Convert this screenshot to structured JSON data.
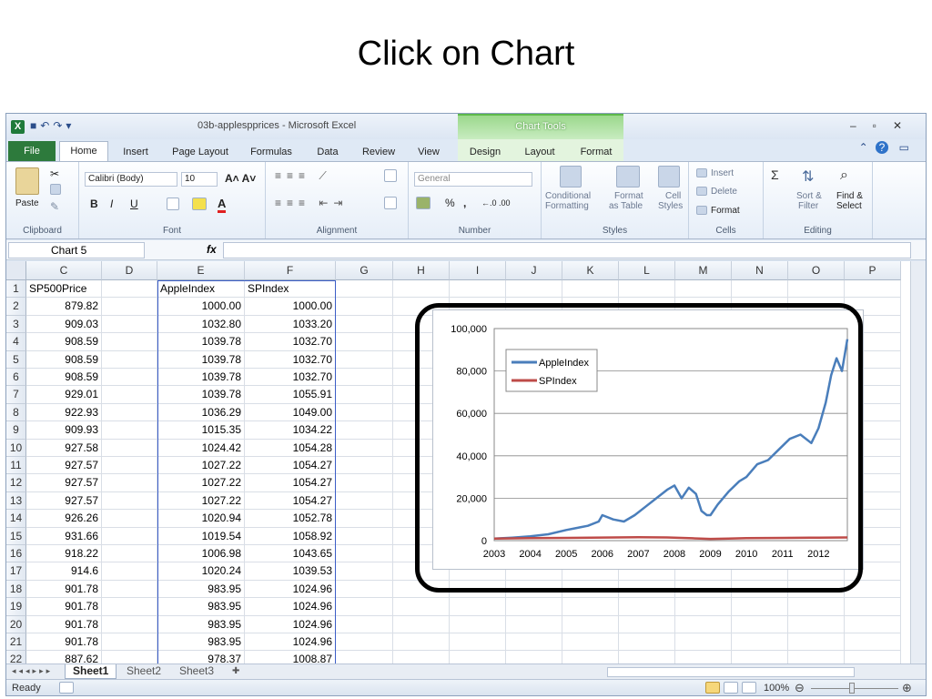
{
  "slide_title": "Click on Chart",
  "window": {
    "title": "03b-applespprices - Microsoft Excel",
    "context_tab_group": "Chart Tools",
    "qat_icons": [
      "save-icon",
      "undo-icon",
      "redo-icon",
      "customize-icon"
    ]
  },
  "ribbon_tabs": [
    "File",
    "Home",
    "Insert",
    "Page Layout",
    "Formulas",
    "Data",
    "Review",
    "View",
    "Design",
    "Layout",
    "Format"
  ],
  "ribbon": {
    "clipboard": {
      "paste": "Paste",
      "label": "Clipboard"
    },
    "font": {
      "family": "Calibri (Body)",
      "size": "10",
      "bold": "B",
      "italic": "I",
      "underline": "U",
      "label": "Font"
    },
    "alignment": {
      "label": "Alignment"
    },
    "number": {
      "format": "General",
      "percent": "%",
      "comma": ",",
      "inc": "←.0 .00",
      "dec": ".00 →.0",
      "label": "Number"
    },
    "styles": {
      "conditional": "Conditional",
      "conditional2": "Formatting",
      "format_table": "Format",
      "format_table2": "as Table",
      "cell_styles": "Cell",
      "cell_styles2": "Styles",
      "label": "Styles"
    },
    "cells": {
      "insert": "Insert",
      "delete": "Delete",
      "format": "Format",
      "label": "Cells"
    },
    "editing": {
      "sum": "Σ",
      "sort": "Sort &",
      "sort2": "Filter",
      "find": "Find &",
      "find2": "Select",
      "label": "Editing"
    }
  },
  "formula_bar": {
    "name_box": "Chart 5",
    "fx": "fx",
    "value": ""
  },
  "columns": [
    "C",
    "D",
    "E",
    "F",
    "G",
    "H",
    "I",
    "J",
    "K",
    "L",
    "M",
    "N",
    "O",
    "P"
  ],
  "rows": [
    {
      "n": "1",
      "c": "SP500Price",
      "e": "AppleIndex",
      "f": "SPIndex"
    },
    {
      "n": "2",
      "c": "879.82",
      "e": "1000.00",
      "f": "1000.00"
    },
    {
      "n": "3",
      "c": "909.03",
      "e": "1032.80",
      "f": "1033.20"
    },
    {
      "n": "4",
      "c": "908.59",
      "e": "1039.78",
      "f": "1032.70"
    },
    {
      "n": "5",
      "c": "908.59",
      "e": "1039.78",
      "f": "1032.70"
    },
    {
      "n": "6",
      "c": "908.59",
      "e": "1039.78",
      "f": "1032.70"
    },
    {
      "n": "7",
      "c": "929.01",
      "e": "1039.78",
      "f": "1055.91"
    },
    {
      "n": "8",
      "c": "922.93",
      "e": "1036.29",
      "f": "1049.00"
    },
    {
      "n": "9",
      "c": "909.93",
      "e": "1015.35",
      "f": "1034.22"
    },
    {
      "n": "10",
      "c": "927.58",
      "e": "1024.42",
      "f": "1054.28"
    },
    {
      "n": "11",
      "c": "927.57",
      "e": "1027.22",
      "f": "1054.27"
    },
    {
      "n": "12",
      "c": "927.57",
      "e": "1027.22",
      "f": "1054.27"
    },
    {
      "n": "13",
      "c": "927.57",
      "e": "1027.22",
      "f": "1054.27"
    },
    {
      "n": "14",
      "c": "926.26",
      "e": "1020.94",
      "f": "1052.78"
    },
    {
      "n": "15",
      "c": "931.66",
      "e": "1019.54",
      "f": "1058.92"
    },
    {
      "n": "16",
      "c": "918.22",
      "e": "1006.98",
      "f": "1043.65"
    },
    {
      "n": "17",
      "c": "914.6",
      "e": "1020.24",
      "f": "1039.53"
    },
    {
      "n": "18",
      "c": "901.78",
      "e": "983.95",
      "f": "1024.96"
    },
    {
      "n": "19",
      "c": "901.78",
      "e": "983.95",
      "f": "1024.96"
    },
    {
      "n": "20",
      "c": "901.78",
      "e": "983.95",
      "f": "1024.96"
    },
    {
      "n": "21",
      "c": "901.78",
      "e": "983.95",
      "f": "1024.96"
    },
    {
      "n": "22",
      "c": "887.62",
      "e": "978.37",
      "f": "1008.87"
    }
  ],
  "sheets": [
    "Sheet1",
    "Sheet2",
    "Sheet3"
  ],
  "status": {
    "ready": "Ready",
    "zoom": "100%"
  },
  "chart_data": {
    "type": "line",
    "title": "",
    "xlabel": "",
    "ylabel": "",
    "x_ticks": [
      "2003",
      "2004",
      "2005",
      "2006",
      "2007",
      "2008",
      "2009",
      "2010",
      "2011",
      "2012"
    ],
    "y_ticks": [
      "0",
      "20,000",
      "40,000",
      "60,000",
      "80,000",
      "100,000"
    ],
    "ylim": [
      0,
      100000
    ],
    "xlim": [
      2003,
      2012.8
    ],
    "grid": "horizontal",
    "legend_position": "top-left",
    "series": [
      {
        "name": "AppleIndex",
        "color": "#4a7ebb",
        "x": [
          2003.0,
          2003.5,
          2004.0,
          2004.5,
          2005.0,
          2005.3,
          2005.6,
          2005.9,
          2006.0,
          2006.3,
          2006.6,
          2006.9,
          2007.2,
          2007.5,
          2007.8,
          2008.0,
          2008.2,
          2008.4,
          2008.6,
          2008.75,
          2008.9,
          2009.0,
          2009.2,
          2009.5,
          2009.8,
          2010.0,
          2010.3,
          2010.6,
          2010.9,
          2011.2,
          2011.5,
          2011.8,
          2012.0,
          2012.2,
          2012.35,
          2012.5,
          2012.65,
          2012.8
        ],
        "y": [
          1000,
          1400,
          2000,
          3000,
          5000,
          6000,
          7000,
          9000,
          12000,
          10000,
          9000,
          12000,
          16000,
          20000,
          24000,
          26000,
          20000,
          25000,
          22000,
          14000,
          12000,
          12000,
          17000,
          23000,
          28000,
          30000,
          36000,
          38000,
          43000,
          48000,
          50000,
          46000,
          53000,
          65000,
          78000,
          86000,
          80000,
          95000
        ]
      },
      {
        "name": "SPIndex",
        "color": "#be4b48",
        "x": [
          2003.0,
          2004.0,
          2005.0,
          2006.0,
          2007.0,
          2007.8,
          2008.5,
          2009.0,
          2009.5,
          2010.0,
          2011.0,
          2012.0,
          2012.8
        ],
        "y": [
          1000,
          1200,
          1300,
          1450,
          1600,
          1500,
          1100,
          800,
          1000,
          1200,
          1300,
          1400,
          1500
        ]
      }
    ]
  }
}
